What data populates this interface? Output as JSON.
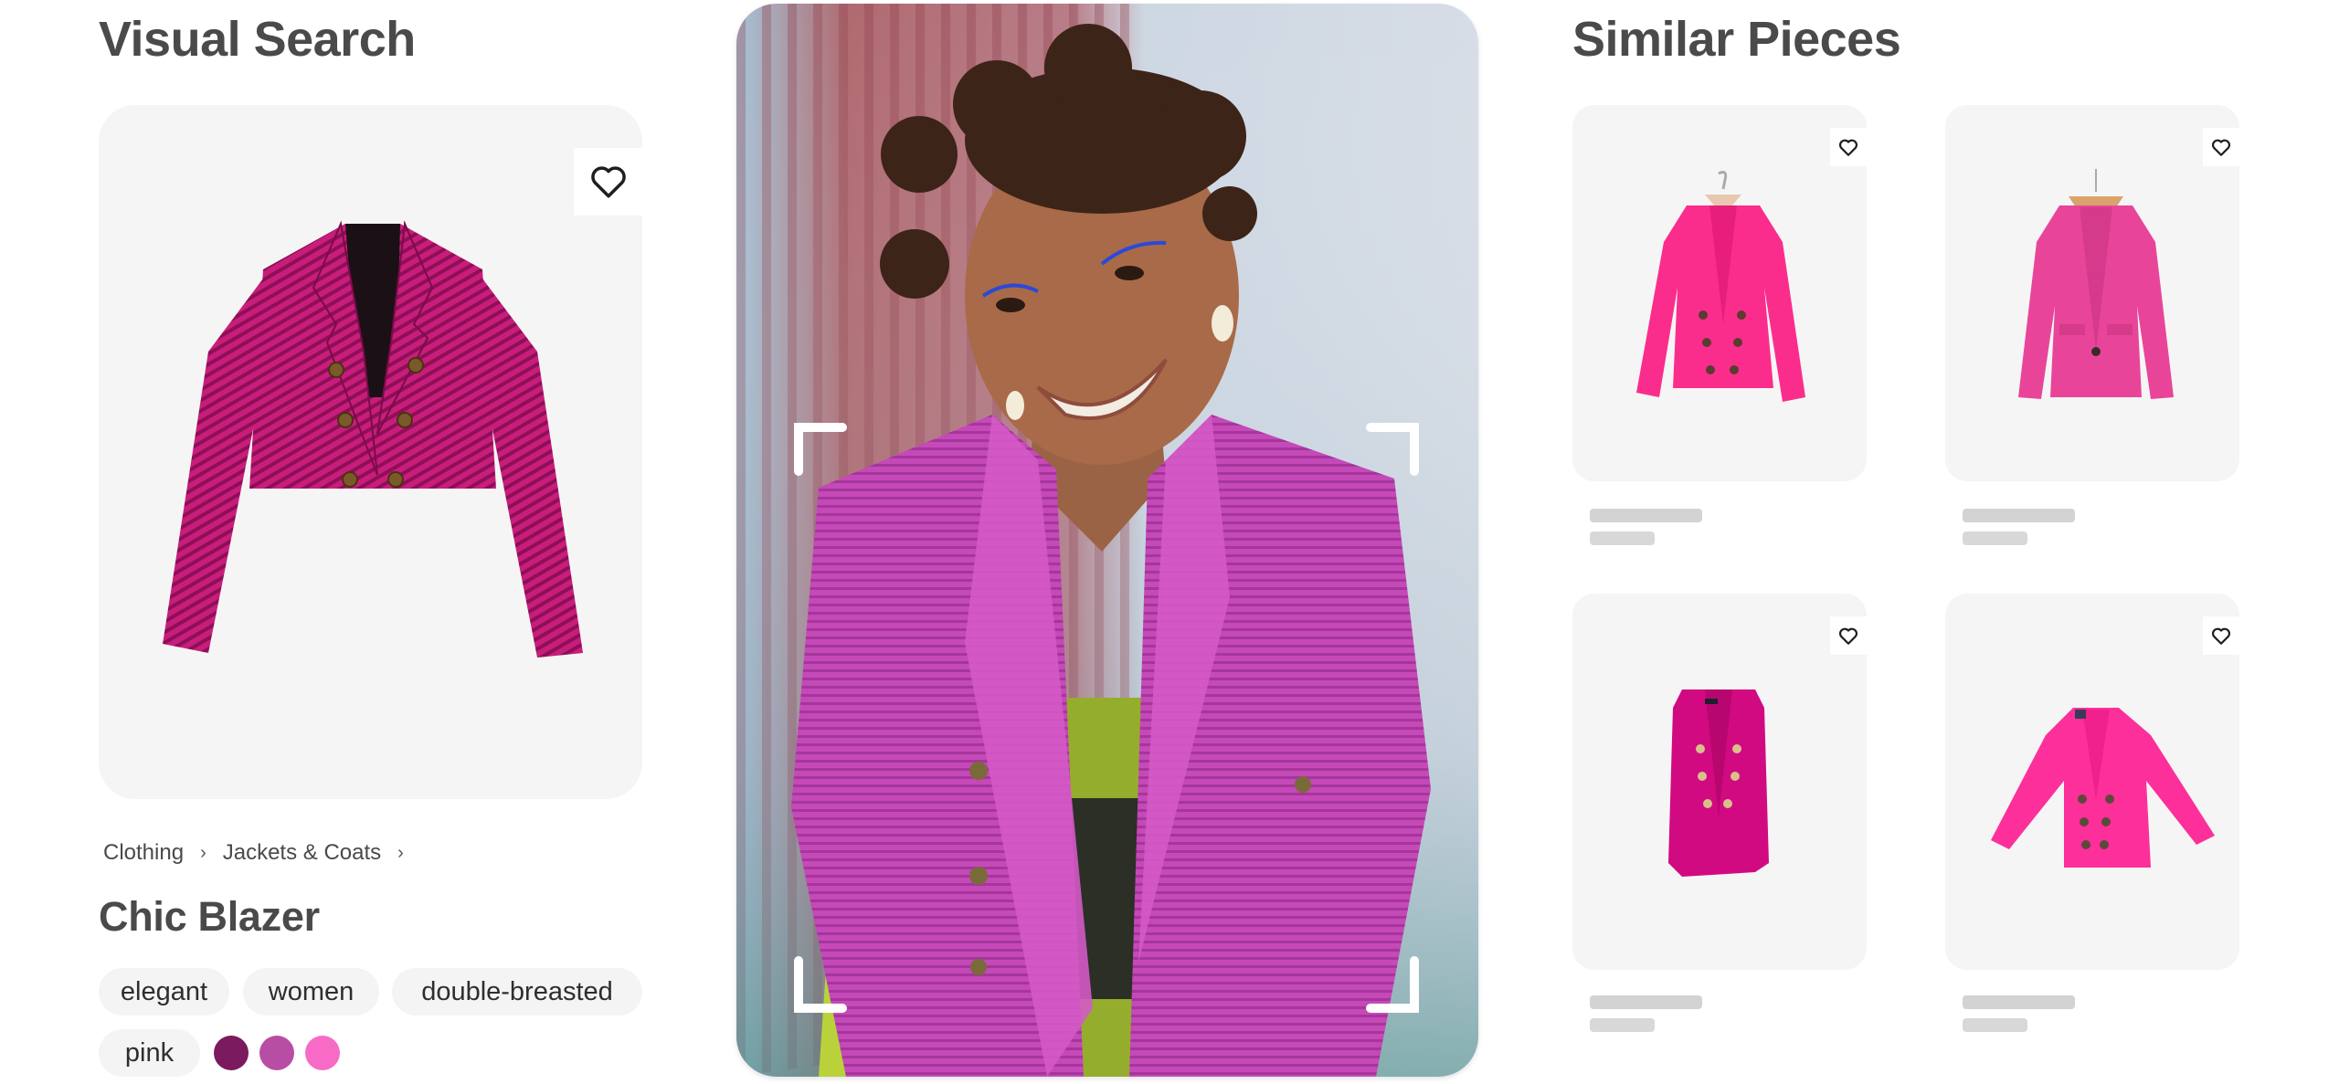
{
  "left": {
    "title": "Visual Search",
    "product": {
      "image_alt": "pink tweed cropped double-breasted blazer",
      "favorite_icon": "heart-outline-icon",
      "breadcrumb": [
        "Clothing",
        "Jackets & Coats"
      ],
      "breadcrumb_separator": "›",
      "name": "Chic Blazer",
      "tags": [
        "elegant",
        "women",
        "double-breasted",
        "pink"
      ],
      "colors": [
        "#7b1a5e",
        "#b84ea3",
        "#f76bc7"
      ]
    }
  },
  "center": {
    "photo_alt": "Smiling woman wearing a pink tweed blazer, with scan frame corners",
    "scan_frame_icon": "scan-corners-icon"
  },
  "right": {
    "title": "Similar Pieces",
    "items": [
      {
        "image_alt": "hot pink corduroy double-breasted blazer on hanger",
        "color": "#fb2d8c",
        "favorite_icon": "heart-outline-icon"
      },
      {
        "image_alt": "pink single-button blazer on wooden hanger",
        "color": "#e8459a",
        "favorite_icon": "heart-outline-icon"
      },
      {
        "image_alt": "magenta long double-breasted blazer with gold buttons",
        "color": "#d10a82",
        "favorite_icon": "heart-outline-icon"
      },
      {
        "image_alt": "bright pink velvet double-breasted blazer",
        "color": "#fd2f9a",
        "favorite_icon": "heart-outline-icon"
      }
    ]
  }
}
